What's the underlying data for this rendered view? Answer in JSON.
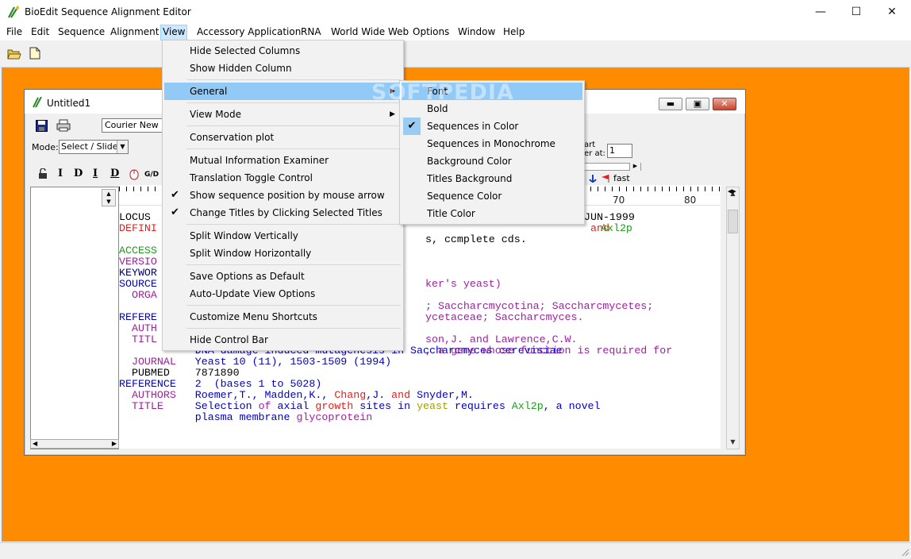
{
  "app": {
    "title": "BioEdit Sequence Alignment Editor",
    "minimize": "—",
    "maximize": "☐",
    "close": "✕"
  },
  "menubar": [
    "File",
    "Edit",
    "Sequence",
    "Alignment",
    "View",
    "Accessory Application",
    "RNA",
    "World Wide Web",
    "Options",
    "Window",
    "Help"
  ],
  "doc": {
    "title": "Untitled1",
    "font": "Courier New",
    "mode_label": "Mode:",
    "mode_value": "Select / Slide",
    "start_label_1": "art",
    "start_label_2": "er at:",
    "start_value": "1",
    "speed_label": "fast",
    "ruler": [
      "70",
      "80"
    ],
    "lines": [
      [
        {
          "t": "LOCUS",
          "c": "#000000"
        }
      ],
      [
        {
          "t": "DEFINI",
          "c": "#e02020"
        }
      ],
      [],
      [
        {
          "t": "ACCESS",
          "c": "#1c9c1c"
        }
      ],
      [
        {
          "t": "VERSIO",
          "c": "#a020a0"
        }
      ],
      [
        {
          "t": "KEYWOR",
          "c": "#000080"
        }
      ],
      [
        {
          "t": "SOURCE",
          "c": "#0000d0"
        }
      ],
      [
        {
          "t": "  ORGA",
          "c": "#a020a0"
        }
      ],
      [],
      [
        {
          "t": "REFERE",
          "c": "#0000d0"
        }
      ],
      [
        {
          "t": "  AUTH",
          "c": "#a020a0"
        }
      ],
      [
        {
          "t": "  TITL",
          "c": "#a020a0"
        }
      ],
      [
        {
          "t": "            DNA damage-induced mutagenesis in Saccharcmyces cerevisiae",
          "c": "#0000c0"
        }
      ],
      [
        {
          "t": "  JOURNAL   ",
          "c": "#a020a0"
        },
        {
          "t": "Yeast 10 (11), 1503-1509 (1994)",
          "c": "#0000c0"
        }
      ],
      [
        {
          "t": "  PUBMED    ",
          "c": "#000000"
        },
        {
          "t": "7871890",
          "c": "#000000"
        }
      ],
      [
        {
          "t": "REFERENCE   ",
          "c": "#0000d0"
        },
        {
          "t": "2  (bases 1 to 5028)",
          "c": "#0000c0"
        }
      ],
      [
        {
          "t": "  AUTHORS   ",
          "c": "#a020a0"
        },
        {
          "t": "Roemer,T., Madden,K., ",
          "c": "#0000c0"
        },
        {
          "t": "Chang",
          "c": "#e02020"
        },
        {
          "t": ",J. ",
          "c": "#0000c0"
        },
        {
          "t": "and",
          "c": "#e02020"
        },
        {
          "t": " Snyder,M.",
          "c": "#0000c0"
        }
      ],
      [
        {
          "t": "  TITLE     ",
          "c": "#a020a0"
        },
        {
          "t": "Selection ",
          "c": "#0000c0"
        },
        {
          "t": "of",
          "c": "#a020a0"
        },
        {
          "t": " axial ",
          "c": "#0000c0"
        },
        {
          "t": "growth",
          "c": "#e02020"
        },
        {
          "t": " sites in ",
          "c": "#0000c0"
        },
        {
          "t": "yeast",
          "c": "#a0a000"
        },
        {
          "t": " requires ",
          "c": "#0000c0"
        },
        {
          "t": "Axl2p",
          "c": "#1c9c1c"
        },
        {
          "t": ", a novel",
          "c": "#0000c0"
        }
      ],
      [
        {
          "t": "            plasma membrane ",
          "c": "#0000c0"
        },
        {
          "t": "glycoprotein",
          "c": "#a020a0"
        }
      ]
    ],
    "right_fragments": [
      {
        "t": "JUN-1999",
        "c": "#000000",
        "line": 0
      },
      {
        "t": "and",
        "c": "#e02020",
        "line": 1
      },
      {
        "t": "Axl2p",
        "c": "#1c9c1c",
        "line": 1
      },
      {
        "t": "s, ccmplete cds.",
        "c": "#000000",
        "line": 2
      },
      {
        "t": "ker's yeast)",
        "c": "#a020a0",
        "line": 6
      },
      {
        "t": "; Saccharcmycotina; Saccharcmycetes;",
        "c": "#a020a0",
        "line": 8
      },
      {
        "t": "ycetaceae; Saccharcmyces.",
        "c": "#a020a0",
        "line": 9
      },
      {
        "t": "son,J. and Lawrence,C.W.",
        "c": "#a020a0",
        "line": 11
      },
      {
        "t": ", a gene whose function is required for",
        "c": "#a020a0",
        "line": 12
      }
    ]
  },
  "view_menu": {
    "items": [
      {
        "label": "Hide Selected Columns",
        "check": false,
        "sub": false
      },
      {
        "label": "Show Hidden Column",
        "check": false,
        "sub": false
      },
      {
        "label": "General",
        "check": false,
        "sub": true,
        "hl": true
      },
      {
        "label": "View Mode",
        "check": false,
        "sub": true
      },
      {
        "label": "Conservation plot",
        "check": false,
        "sub": false
      },
      {
        "label": "Mutual Information Examiner",
        "check": false,
        "sub": false
      },
      {
        "label": "Translation Toggle Control",
        "check": false,
        "sub": false
      },
      {
        "label": "Show sequence position by mouse arrow",
        "check": true,
        "sub": false
      },
      {
        "label": "Change Titles by Clicking Selected Titles",
        "check": true,
        "sub": false
      },
      {
        "label": "Split Window Vertically",
        "check": false,
        "sub": false
      },
      {
        "label": "Split Window Horizontally",
        "check": false,
        "sub": false
      },
      {
        "label": "Save Options as Default",
        "check": false,
        "sub": false
      },
      {
        "label": "Auto-Update View Options",
        "check": false,
        "sub": false
      },
      {
        "label": "Customize Menu Shortcuts",
        "check": false,
        "sub": false
      },
      {
        "label": "Hide Control Bar",
        "check": false,
        "sub": false
      }
    ]
  },
  "general_submenu": {
    "items": [
      {
        "label": "Font",
        "hl": true,
        "check": false
      },
      {
        "label": "Bold",
        "check": false
      },
      {
        "label": "Sequences in Color",
        "check": true
      },
      {
        "label": "Sequences in Monochrome",
        "check": false
      },
      {
        "label": "Background Color",
        "check": false
      },
      {
        "label": "Titles Background",
        "check": false
      },
      {
        "label": "Sequence Color",
        "check": false
      },
      {
        "label": "Title Color",
        "check": false
      }
    ]
  },
  "watermark": "SOFTPEDIA",
  "colors": {
    "workspace": "#ff8c00",
    "menu_highlight": "#91c9f7",
    "check_bg": "#99ccf3"
  }
}
